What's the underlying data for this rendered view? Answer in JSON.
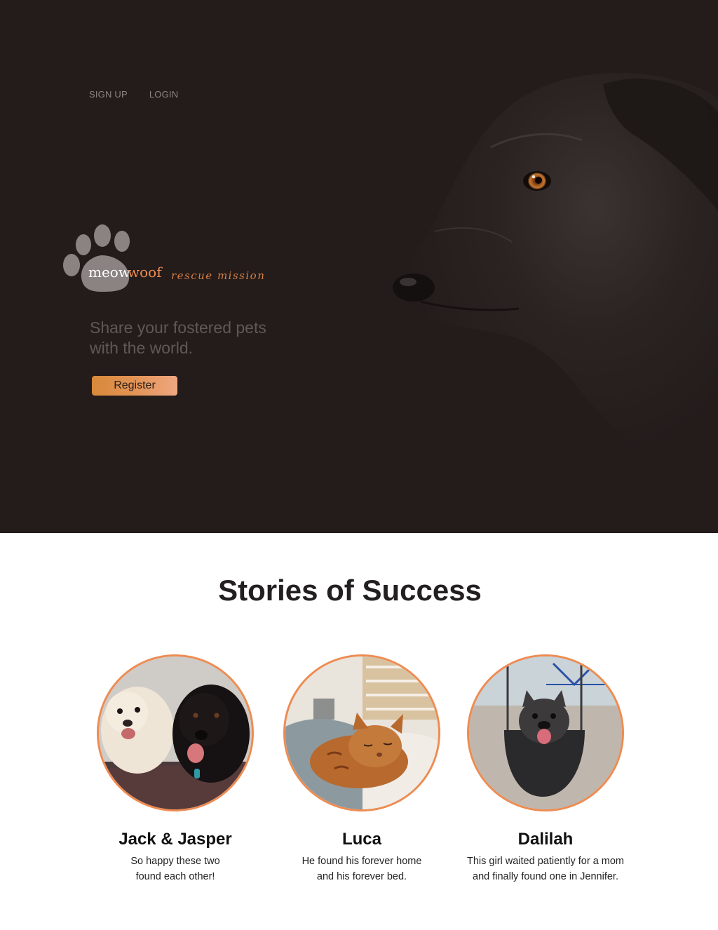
{
  "nav": {
    "signup_label": "SIGN UP",
    "login_label": "LOGIN"
  },
  "logo": {
    "word_meow": "meow",
    "word_woof": "woof",
    "script": "rescue mission"
  },
  "hero": {
    "tagline_line1": "Share your fostered pets",
    "tagline_line2": "with the world.",
    "register_label": "Register"
  },
  "stories": {
    "title": "Stories of Success",
    "items": [
      {
        "name": "Jack & Jasper",
        "line1": "So happy these two",
        "line2": "found each other!"
      },
      {
        "name": "Luca",
        "line1": "He found his forever home",
        "line2": "and his forever bed."
      },
      {
        "name": "Dalilah",
        "line1": "This girl waited patiently for a mom",
        "line2": "and finally found one in Jennifer."
      }
    ]
  },
  "colors": {
    "hero_bg": "#231c1b",
    "accent": "#ee8c52",
    "button": "#e3955a",
    "title": "#231f20"
  }
}
